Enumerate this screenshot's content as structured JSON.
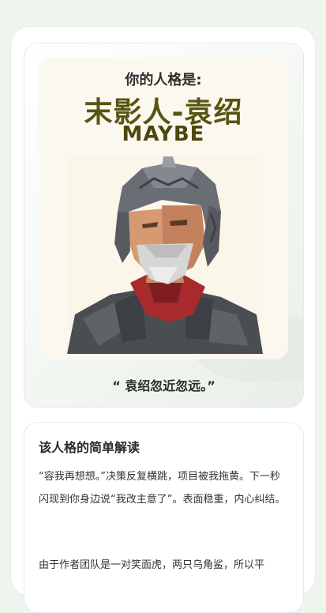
{
  "result": {
    "pre_title": "你的人格是:",
    "title": "末影人-袁绍",
    "subtitle": "MAYBE",
    "quote": "“ 袁绍忽近忽远。”"
  },
  "icons": {
    "portrait": "warrior-portrait-icon"
  },
  "description": {
    "heading": "该人格的简单解读",
    "paragraph1": "“容我再想想。”决策反复横跳，项目被我拖黄。下一秒闪现到你身边说“我改主意了”。表面稳重，内心纠结。",
    "paragraph2": "由于作者团队是一对笑面虎，两只乌角鲨，所以平"
  },
  "colors": {
    "page_bg": "#eef5ef",
    "title": "#5a5414",
    "panel_bg": "#fbf8ef"
  }
}
